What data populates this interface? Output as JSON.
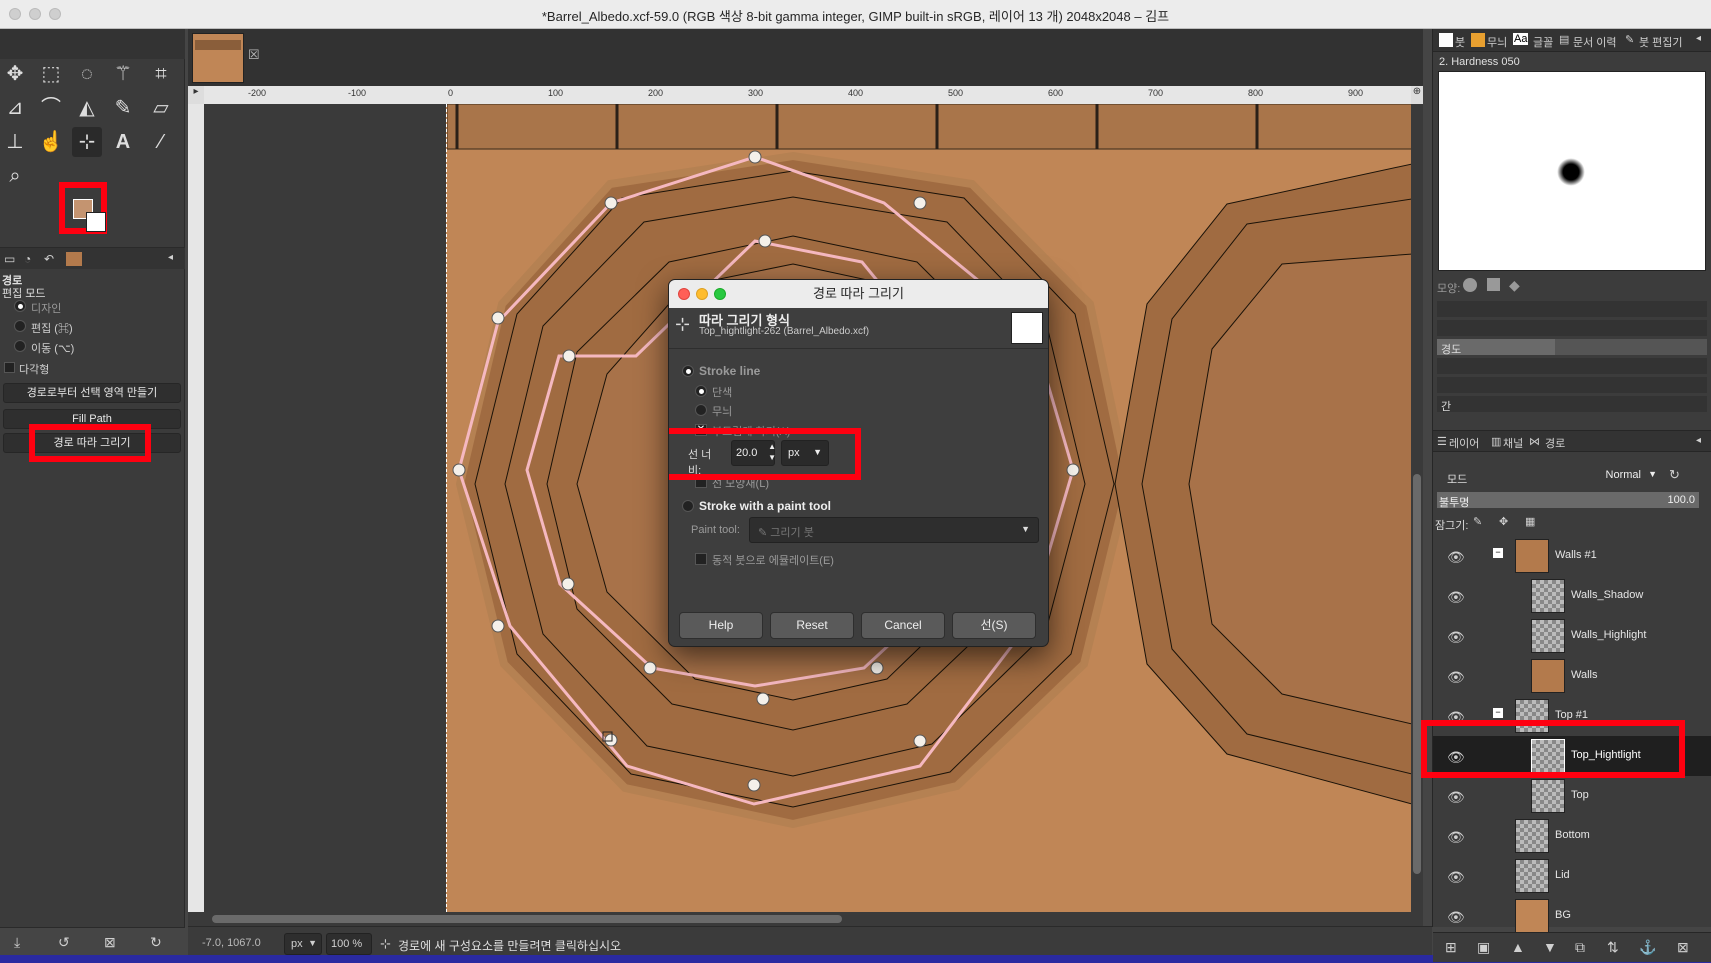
{
  "window": {
    "title": "*Barrel_Albedo.xcf-59.0 (RGB 색상 8-bit gamma integer, GIMP built-in sRGB, 레이어 13 개) 2048x2048 – 김프"
  },
  "tool_options": {
    "section": "경로",
    "edit_mode_label": "편집 모드",
    "modes": [
      "디자인",
      "편집 (⌘)",
      "이동 (⌥)"
    ],
    "polygonal": "다각형",
    "btn_selection": "경로로부터 선택 영역 만들기",
    "btn_fill": "Fill Path",
    "btn_stroke": "경로 따라 그리기"
  },
  "ruler_labels": [
    "-200",
    "-100",
    "0",
    "100",
    "200",
    "300",
    "400",
    "500",
    "600",
    "700",
    "800",
    "900"
  ],
  "dialog": {
    "title": "경로 따라 그리기",
    "header": "따라 그리기 형식",
    "subheader": "Top_hightlight-262 (Barrel_Albedo.xcf)",
    "stroke_line": "Stroke line",
    "solid": "단색",
    "pattern": "무늬",
    "antialias": "부드럽게 하기(A)",
    "line_width_label": "선 너비:",
    "line_width_value": "20.0",
    "unit": "px",
    "line_style": "선 모양새(L)",
    "stroke_paint": "Stroke with a paint tool",
    "paint_tool_label": "Paint tool:",
    "paint_tool_value": "그리기 붓",
    "emulate": "동적 붓으로 에뮬레이트(E)",
    "btn_help": "Help",
    "btn_reset": "Reset",
    "btn_cancel": "Cancel",
    "btn_ok": "선(S)"
  },
  "brush_panel": {
    "tabs": [
      "붓",
      "무늬",
      "글꼴",
      "문서 이력",
      "붓 편집기"
    ],
    "brush_name": "2. Hardness 050",
    "shape_label": "모양:",
    "hardness_label": "경도",
    "spacing_label": "간"
  },
  "layers_panel": {
    "tabs": [
      "레이어",
      "채널",
      "경로"
    ],
    "mode_label": "모드",
    "mode_value": "Normal",
    "opacity_label": "불투명",
    "opacity_value": "100.0",
    "lock_label": "잠그기:",
    "layers": [
      {
        "name": "Walls #1",
        "group": true,
        "indent": 0
      },
      {
        "name": "Walls_Shadow",
        "group": false,
        "indent": 1
      },
      {
        "name": "Walls_Highlight",
        "group": false,
        "indent": 1
      },
      {
        "name": "Walls",
        "group": false,
        "indent": 1
      },
      {
        "name": "Top #1",
        "group": true,
        "indent": 0
      },
      {
        "name": "Top_Hightlight",
        "group": false,
        "indent": 1,
        "selected": true
      },
      {
        "name": "Top",
        "group": false,
        "indent": 1
      },
      {
        "name": "Bottom",
        "group": false,
        "indent": 0
      },
      {
        "name": "Lid",
        "group": false,
        "indent": 0
      },
      {
        "name": "BG",
        "group": false,
        "indent": 0
      }
    ]
  },
  "status": {
    "coords": "-7.0, 1067.0",
    "unit": "px",
    "zoom": "100 %",
    "message": "경로에 새 구성요소를 만들려면 클릭하십시오"
  }
}
